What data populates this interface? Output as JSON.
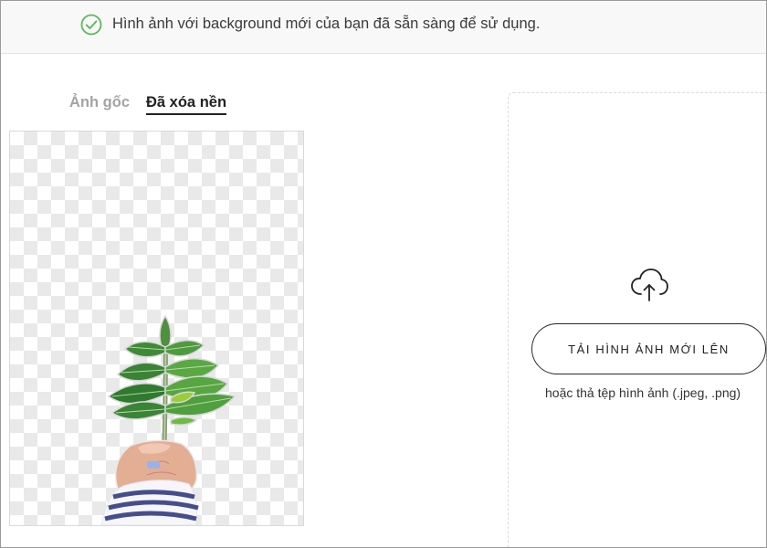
{
  "notice": {
    "text": "Hình ảnh với background mới của bạn đã sẵn sàng để sử dụng.",
    "icon": "check-circle-icon",
    "icon_color": "#5cb85c"
  },
  "tabs": [
    {
      "label": "Ảnh gốc",
      "active": false
    },
    {
      "label": "Đã xóa nền",
      "active": true
    }
  ],
  "upload": {
    "icon": "cloud-upload-icon",
    "button_label": "TẢI HÌNH ẢNH MỚI LÊN",
    "hint": "hoặc thả tệp hình ảnh (.jpeg, .png)"
  }
}
